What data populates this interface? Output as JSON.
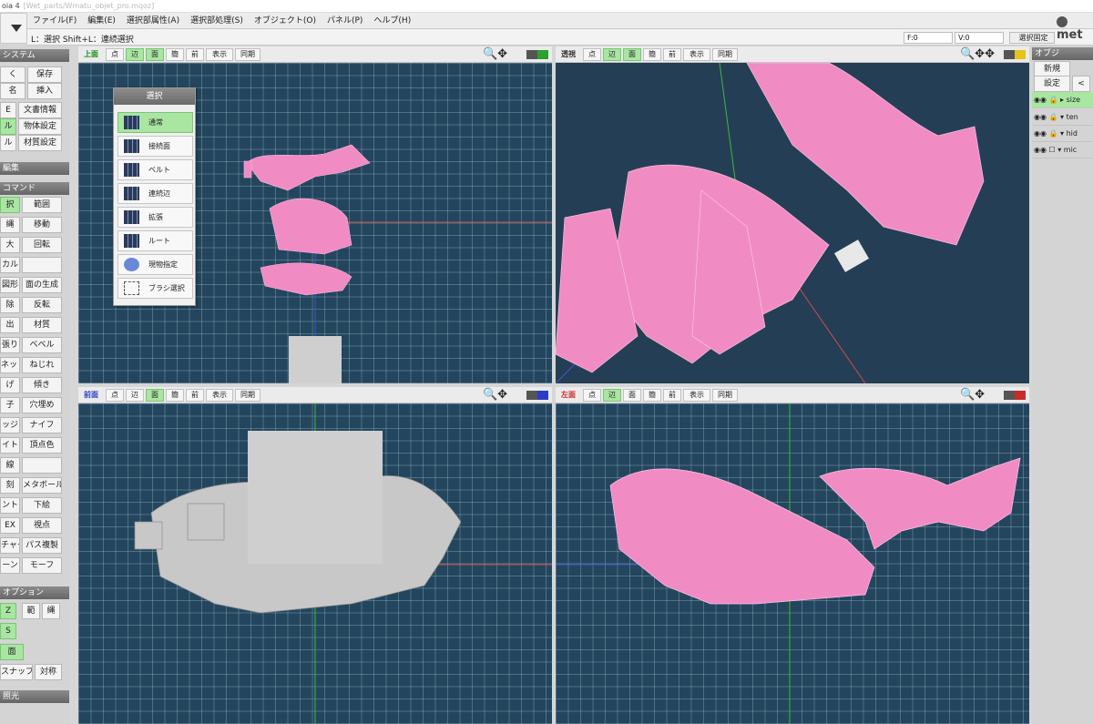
{
  "window": {
    "title": "oia 4",
    "path": "[Wet_parts/Wmatu_objet_pro.mqoz]"
  },
  "menu": [
    "ファイル(F)",
    "編集(E)",
    "選択部属性(A)",
    "選択部処理(S)",
    "オブジェクト(O)",
    "パネル(P)",
    "ヘルプ(H)"
  ],
  "status": {
    "hint": "L：選択  Shift+L：連続選択",
    "faces": "F:0",
    "verts": "V:0",
    "lock_btn": "選択固定"
  },
  "logo": {
    "text": "met"
  },
  "left": {
    "system_title": "システム",
    "system_buttons": [
      "く",
      "保存",
      "名",
      "挿入",
      "E",
      "文書情報",
      "ル",
      "物体設定",
      "ル",
      "材質設定"
    ],
    "edit_title": "編集",
    "command_title": "コマンド",
    "commands": [
      "択",
      "範囲",
      "縄",
      "移動",
      "大",
      "回転",
      "カル",
      "",
      "図形",
      "面の生成",
      "除",
      "反転",
      "出",
      "材質",
      "張り",
      "ベベル",
      "ネット",
      "ねじれ",
      "げ",
      "傾き",
      "子",
      "穴埋め",
      "ッジ",
      "ナイフ",
      "イト",
      "頂点色",
      "線",
      "",
      "刻",
      "メタボール",
      "ント",
      "下絵",
      "EX",
      "視点",
      "チャー",
      "パス複製",
      "ーン",
      "モーフ"
    ],
    "option_title": "オプション",
    "options": [
      "Z",
      "範",
      "縄",
      "S",
      "面",
      "スナップ",
      "対称"
    ],
    "light_title": "照光"
  },
  "viewports": {
    "top": {
      "label": "上面",
      "buttons": [
        "点",
        "辺",
        "面",
        "簡",
        "前",
        "表示",
        "同期"
      ]
    },
    "persp": {
      "label": "透視",
      "buttons": [
        "点",
        "辺",
        "面",
        "簡",
        "前",
        "表示",
        "同期"
      ]
    },
    "front": {
      "label": "前面",
      "buttons": [
        "点",
        "辺",
        "面",
        "簡",
        "前",
        "表示",
        "同期"
      ]
    },
    "left": {
      "label": "左面",
      "buttons": [
        "点",
        "辺",
        "面",
        "簡",
        "前",
        "表示",
        "同期"
      ]
    }
  },
  "palette": {
    "title": "選択",
    "items": [
      "通常",
      "接続面",
      "ベルト",
      "連続辺",
      "拡張",
      "ルート",
      "現物指定",
      "ブラシ選択"
    ]
  },
  "right": {
    "title": "オブジ",
    "buttons": [
      "新規",
      "設定",
      "<"
    ],
    "objects": [
      "size",
      "ten",
      "hid",
      "mic"
    ]
  },
  "colors": {
    "accent_on": "#a9e6a2",
    "viewport_bg": "#23465e",
    "mesh": "#f08cc3"
  }
}
